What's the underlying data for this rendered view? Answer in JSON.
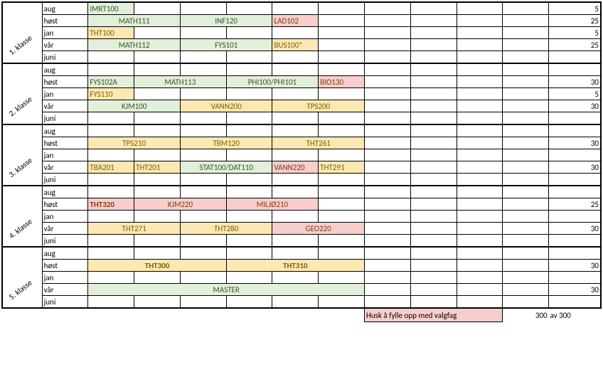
{
  "klasse_labels": [
    "1. klasse",
    "2. klasse",
    "3. klasse",
    "4. klasse",
    "5. klasse"
  ],
  "sem": {
    "aug": "aug",
    "host": "høst",
    "jan": "jan",
    "var": "vår",
    "juni": "juni"
  },
  "k1": {
    "aug": {
      "c": "IMRT100",
      "pts": "5"
    },
    "host": {
      "c1": "MATH111",
      "c2": "INF120",
      "c3": "LAD102",
      "pts": "25"
    },
    "jan": {
      "c": "THT100",
      "pts": "5"
    },
    "var": {
      "c1": "MATH112",
      "c2": "FYS101",
      "c3": "BUS100*",
      "pts": "25"
    }
  },
  "k2": {
    "host": {
      "c1": "FYS102A",
      "c2": "MATH113",
      "c3": "PHI100/PHI101",
      "c4": "BIO130",
      "pts": "30"
    },
    "jan": {
      "c": "FYS110",
      "pts": "5"
    },
    "var": {
      "c1": "KJM100",
      "c2": "VANN200",
      "c3": "TPS200",
      "pts": "30"
    }
  },
  "k3": {
    "host": {
      "c1": "TPS210",
      "c2": "TBM120",
      "c3": "THT261",
      "pts": "30"
    },
    "var": {
      "c1": "TBA201",
      "c2": "THT201",
      "c3": "STAT100/DAT110",
      "c4": "VANN220",
      "c5": "THT291",
      "pts": "30"
    }
  },
  "k4": {
    "host": {
      "c1": "THT320",
      "c2": "KJM220",
      "c3": "MILJØ210",
      "pts": "25"
    },
    "var": {
      "c1": "THT271",
      "c2": "THT280",
      "c3": "GEO220",
      "pts": "30"
    }
  },
  "k5": {
    "host": {
      "c1": "THT300",
      "c2": "THT310",
      "pts": "30"
    },
    "var": {
      "c1": "MASTER",
      "pts": "30"
    }
  },
  "footer": {
    "note": "Husk å fylle opp med valgfag",
    "total": "300",
    "av": "av 300"
  }
}
